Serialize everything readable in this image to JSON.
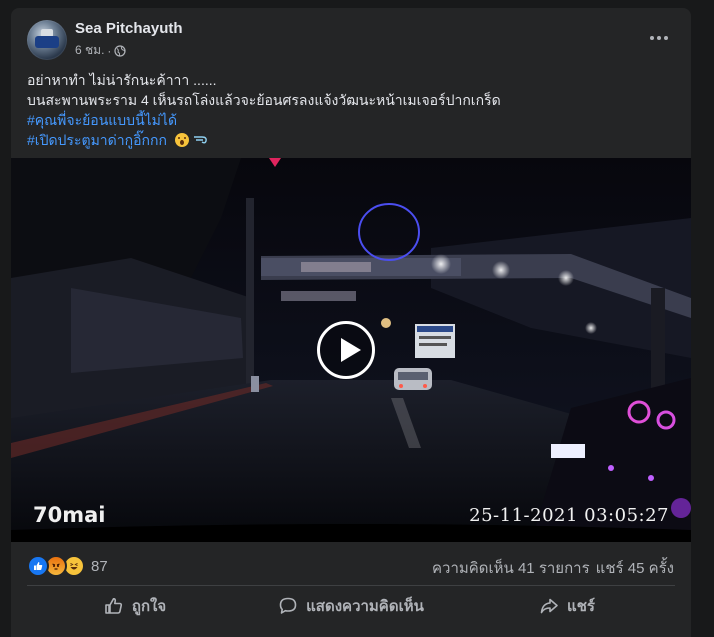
{
  "post": {
    "author": "Sea Pitchayuth",
    "time": "6 ชม.",
    "separator": "·",
    "privacy_icon": "globe-icon",
    "caption_lines": [
      "อย่าหาทำ ไม่น่ารักนะค้าาา ......",
      "บนสะพานพระราม 4 เห็นรถโล่งแล้วจะย้อนศรลงแจ้งวัฒนะหน้าเมเจอร์ปากเกร็ด"
    ],
    "hashtags": [
      "#คุณพี่จะย้อนแบบนี้ไม่ได้",
      "#เปิดประตูมาด่ากูอิ๊กกก"
    ],
    "hashtag_emojis": [
      "astonished-face-emoji",
      "dash-emoji"
    ]
  },
  "video": {
    "brand": "70mai",
    "timestamp": "25-11-2021 03:05:27",
    "play_icon": "play-icon"
  },
  "stats": {
    "reaction_icons": [
      "like-reaction-icon",
      "angry-reaction-icon",
      "haha-reaction-icon"
    ],
    "reaction_count": "87",
    "comments": "ความคิดเห็น 41 รายการ",
    "shares": "แชร์ 45 ครั้ง"
  },
  "actions": {
    "like": "ถูกใจ",
    "comment": "แสดงความคิดเห็น",
    "share": "แชร์"
  },
  "colors": {
    "background": "#18191a",
    "card": "#242526",
    "text": "#e4e6eb",
    "secondary": "#b0b3b8",
    "hashtag": "#4599ff",
    "like_blue": "#1877f2"
  }
}
